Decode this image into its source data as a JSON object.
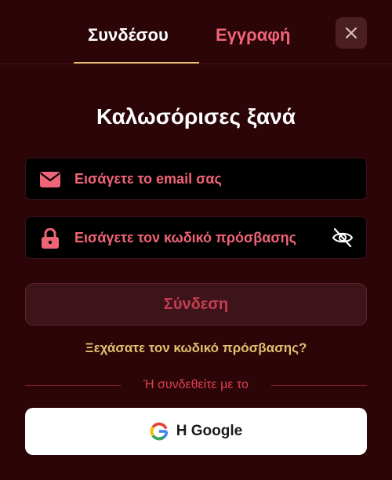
{
  "tabs": {
    "login": "Συνδέσου",
    "register": "Εγγραφή"
  },
  "heading": "Καλωσόρισες ξανά",
  "email": {
    "placeholder": "Εισάγετε το email σας",
    "icon": "envelope-icon"
  },
  "password": {
    "placeholder": "Εισάγετε τον κωδικό πρόσβασης",
    "icon": "lock-icon",
    "toggle_icon": "eye-slash-icon"
  },
  "submit_label": "Σύνδεση",
  "forgot_label": "Ξεχάσατε τον κωδικό πρόσβασης?",
  "divider_text": "Ή συνδεθείτε με το",
  "google": {
    "label": "Η Google",
    "icon": "google-icon"
  },
  "colors": {
    "background": "#2b0508",
    "accent_pink": "#f06477",
    "accent_gold": "#e2bf6e",
    "submit_text": "#c53d52"
  }
}
